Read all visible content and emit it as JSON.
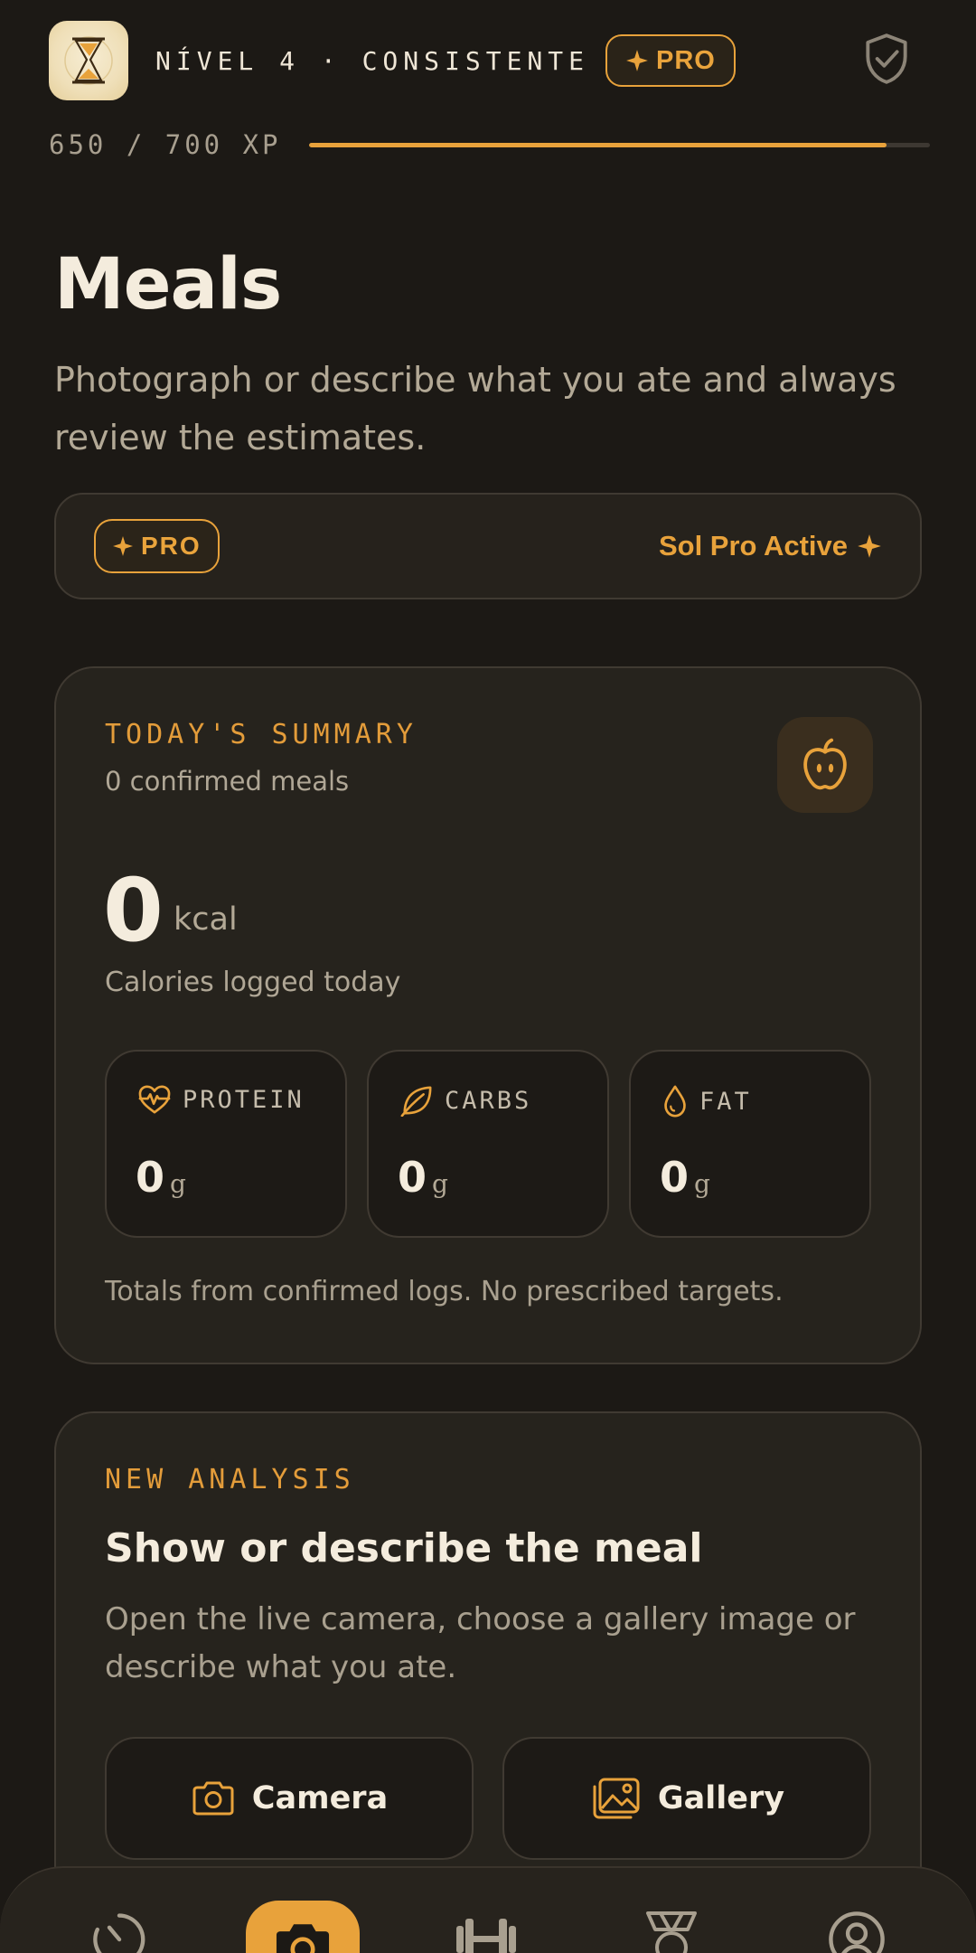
{
  "header": {
    "level_text": "NÍVEL 4 · CONSISTENTE",
    "pro_badge": "PRO",
    "xp_text": "650 / 700 XP",
    "xp_progress": 0.93
  },
  "page": {
    "title": "Meals",
    "subtitle": "Photograph or describe what you ate and always review the estimates."
  },
  "pro_banner": {
    "badge": "PRO",
    "status": "Sol Pro Active"
  },
  "summary": {
    "eyebrow": "TODAY'S SUMMARY",
    "meta": "0 confirmed meals",
    "calories": "0",
    "calories_unit": "kcal",
    "calories_label": "Calories logged today",
    "macros": [
      {
        "label": "PROTEIN",
        "value": "0",
        "unit": "g",
        "icon": "heart-pulse-icon"
      },
      {
        "label": "CARBS",
        "value": "0",
        "unit": "g",
        "icon": "leaf-icon"
      },
      {
        "label": "FAT",
        "value": "0",
        "unit": "g",
        "icon": "droplet-icon"
      }
    ],
    "note": "Totals from confirmed logs. No prescribed targets."
  },
  "analysis": {
    "eyebrow": "NEW ANALYSIS",
    "title": "Show or describe the meal",
    "description": "Open the live camera, choose a gallery image or describe what you ate.",
    "camera_label": "Camera",
    "gallery_label": "Gallery"
  },
  "nav": {
    "items": [
      {
        "icon": "gauge-icon",
        "active": false
      },
      {
        "icon": "camera-icon",
        "active": true
      },
      {
        "icon": "dumbbell-icon",
        "active": false
      },
      {
        "icon": "medal-icon",
        "active": false
      },
      {
        "icon": "profile-icon",
        "active": false
      }
    ]
  },
  "colors": {
    "background": "#1c1915",
    "card": "#26231d",
    "accent": "#e8a23b",
    "text": "#f4ecdd",
    "muted": "#a9a08f"
  }
}
